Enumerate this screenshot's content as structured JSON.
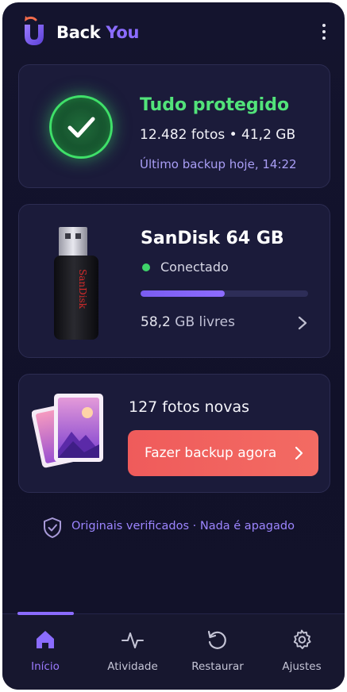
{
  "app": {
    "title_part1": "Back",
    "title_part2": "You",
    "brand_color": "#8b6cff"
  },
  "header": {
    "menu_icon": "more-vertical-icon"
  },
  "status": {
    "title": "Tudo protegido",
    "stats": "12.482 fotos • 41,2 GB",
    "last_backup": "Último backup hoje, 14:22",
    "icon": "check-icon",
    "color": "#52e37a"
  },
  "drive": {
    "name": "SanDisk 64 GB",
    "connection": "Conectado",
    "free_value": "58,2",
    "free_unit": "GB livres",
    "usage_fraction": 0.5,
    "brand_text": "SanDisk",
    "icon": "usb-drive-icon"
  },
  "backup": {
    "new_photos": "127 fotos novas",
    "button_label": "Fazer backup agora",
    "button_color": "#ef5b5b",
    "icon": "photos-icon"
  },
  "note": {
    "text": "Originais verificados · Nada é apagado",
    "icon": "shield-check-icon"
  },
  "nav": {
    "items": [
      {
        "label": "Início",
        "icon": "home-icon",
        "active": true
      },
      {
        "label": "Atividade",
        "icon": "activity-icon",
        "active": false
      },
      {
        "label": "Restaurar",
        "icon": "restore-icon",
        "active": false
      },
      {
        "label": "Ajustes",
        "icon": "gear-icon",
        "active": false
      }
    ]
  }
}
